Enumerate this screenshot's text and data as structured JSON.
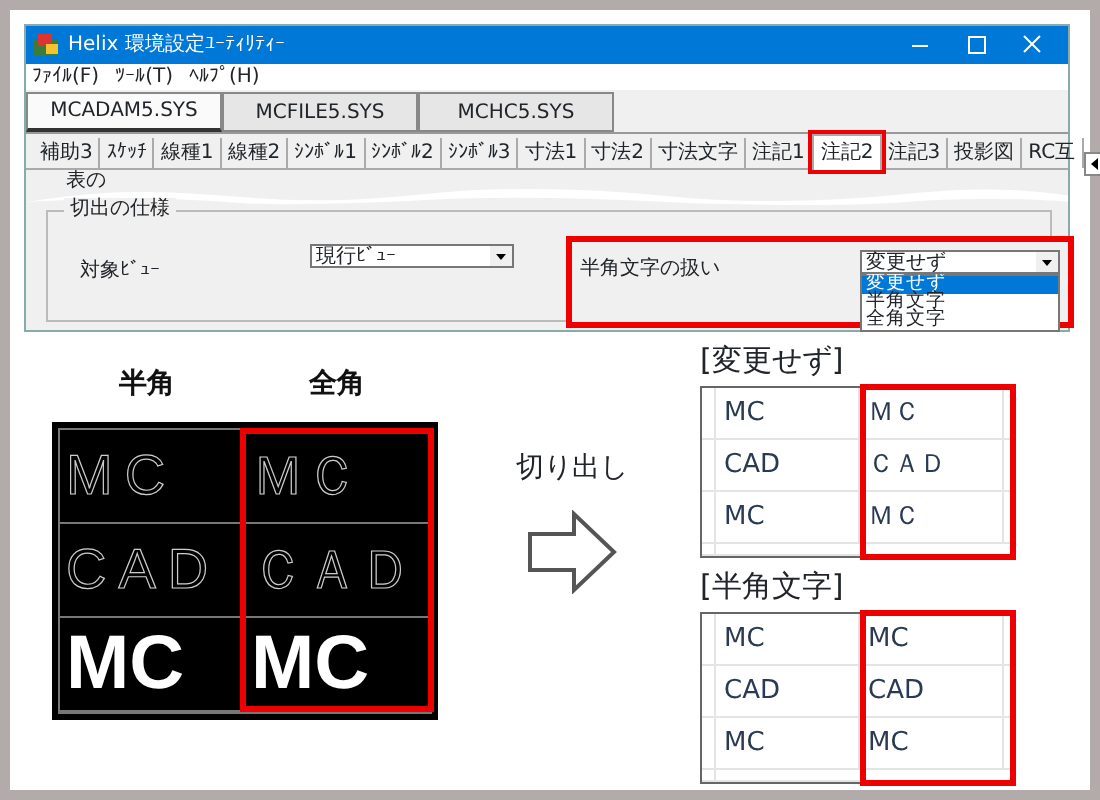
{
  "window": {
    "title": "Helix 環境設定ﾕｰﾃｨﾘﾃｨｰ",
    "menu": [
      "ﾌｧｲﾙ(F)",
      "ﾂｰﾙ(T)",
      "ﾍﾙﾌﾟ(H)"
    ],
    "file_tabs": [
      {
        "label": "MCADAM5.SYS",
        "selected": true
      },
      {
        "label": "MCFILE5.SYS",
        "selected": false
      },
      {
        "label": "MCHC5.SYS",
        "selected": false
      }
    ],
    "sub_tabs": [
      {
        "label": "補助3",
        "selected": false
      },
      {
        "label": "ｽｹｯﾁ",
        "selected": false
      },
      {
        "label": "線種1",
        "selected": false
      },
      {
        "label": "線種2",
        "selected": false
      },
      {
        "label": "ｼﾝﾎﾞﾙ1",
        "selected": false
      },
      {
        "label": "ｼﾝﾎﾞﾙ2",
        "selected": false
      },
      {
        "label": "ｼﾝﾎﾞﾙ3",
        "selected": false
      },
      {
        "label": "寸法1",
        "selected": false
      },
      {
        "label": "寸法2",
        "selected": false
      },
      {
        "label": "寸法文字",
        "selected": false
      },
      {
        "label": "注記1",
        "selected": false
      },
      {
        "label": "注記2",
        "selected": true
      },
      {
        "label": "注記3",
        "selected": false
      },
      {
        "label": "投影図",
        "selected": false
      },
      {
        "label": "RC互",
        "selected": false
      }
    ],
    "cut_text": "表の",
    "group": {
      "title": "切出の仕様",
      "view_label": "対象ﾋﾞｭｰ",
      "view_value": "現行ﾋﾞｭｰ",
      "halfwidth_label": "半角文字の扱い",
      "halfwidth_value": "変更せず",
      "options": [
        {
          "label": "変更せず",
          "selected": true
        },
        {
          "label": "半角文字",
          "selected": false
        },
        {
          "label": "全角文字",
          "selected": false
        }
      ]
    }
  },
  "diagram": {
    "column_headers": [
      "半角",
      "全角"
    ],
    "rows": [
      {
        "kind": "outline",
        "cells": [
          "MC",
          "ＭＣ"
        ]
      },
      {
        "kind": "outline",
        "cells": [
          "CAD",
          "ＣＡＤ"
        ]
      },
      {
        "kind": "bold",
        "cells": [
          "MC",
          "MC"
        ]
      }
    ],
    "arrow_label": "切り出し",
    "results": [
      {
        "title": "[変更せず]",
        "rows": [
          [
            "MC",
            "ＭＣ"
          ],
          [
            "CAD",
            "ＣＡＤ"
          ],
          [
            "MC",
            "ＭＣ"
          ]
        ]
      },
      {
        "title": "[半角文字]",
        "rows": [
          [
            "MC",
            "MC"
          ],
          [
            "CAD",
            "CAD"
          ],
          [
            "MC",
            "MC"
          ]
        ]
      }
    ]
  }
}
